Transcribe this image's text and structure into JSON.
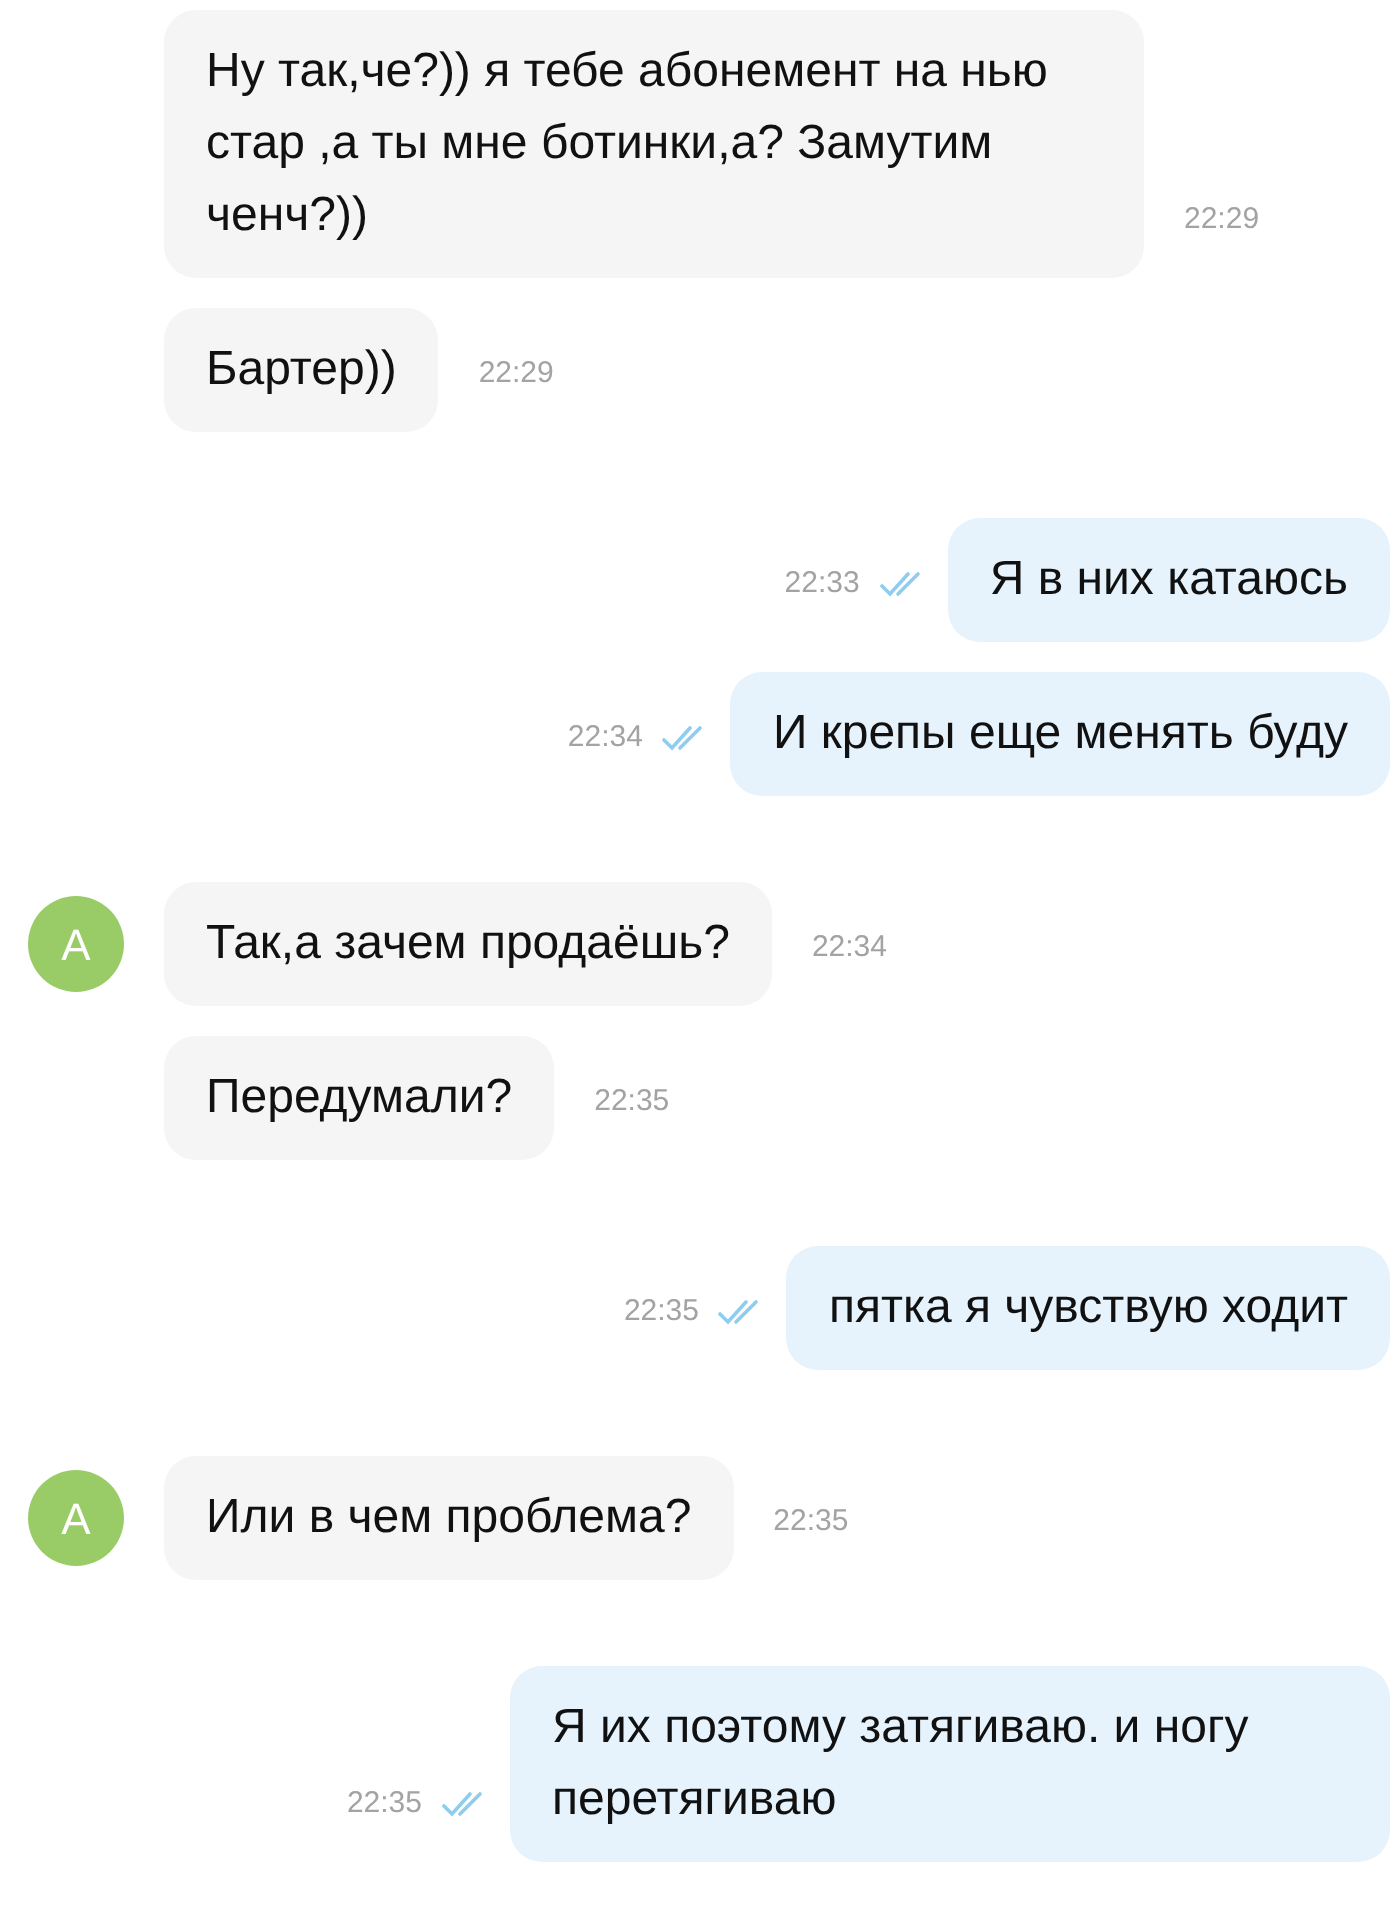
{
  "groups": [
    {
      "kind": "incoming",
      "messages": [
        {
          "text": "Ну так,че?)) я тебе абонемент на нью стар ,а ты мне ботинки,а? Замутим ченч?))",
          "time": "22:29"
        },
        {
          "text": "Бартер))",
          "time": "22:29"
        }
      ]
    },
    {
      "kind": "outgoing",
      "messages": [
        {
          "text": "Я в них катаюсь",
          "time": "22:33",
          "read": true
        },
        {
          "text": "И крепы еще менять буду",
          "time": "22:34",
          "read": true
        }
      ]
    },
    {
      "kind": "incoming",
      "messages": [
        {
          "avatar": "А",
          "text": "Так,а зачем продаёшь?",
          "time": "22:34"
        },
        {
          "text": "Передумали?",
          "time": "22:35"
        }
      ]
    },
    {
      "kind": "outgoing",
      "messages": [
        {
          "text": "пятка я чувствую ходит",
          "time": "22:35",
          "read": true
        }
      ]
    },
    {
      "kind": "incoming",
      "messages": [
        {
          "avatar": "А",
          "text": "Или в чем проблема?",
          "time": "22:35"
        }
      ]
    },
    {
      "kind": "outgoing",
      "messages": [
        {
          "text": "Я их поэтому затягиваю. и ногу перетягиваю",
          "time": "22:35",
          "read": true
        }
      ]
    }
  ]
}
